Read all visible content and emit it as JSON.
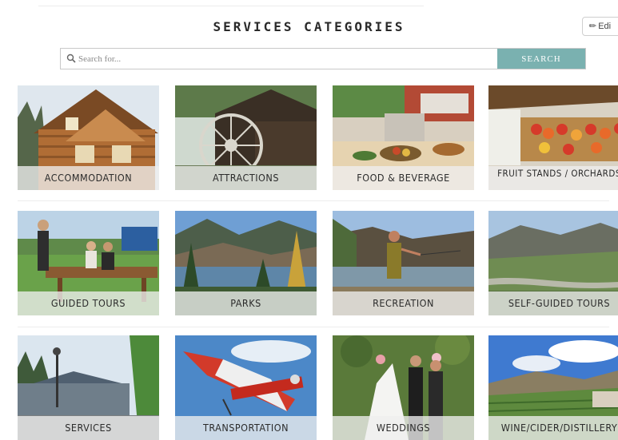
{
  "page": {
    "title": "SERVICES CATEGORIES",
    "edit_label": "Edi"
  },
  "search": {
    "placeholder": "Search for...",
    "button_label": "SEARCH"
  },
  "colors": {
    "search_button": "#7ab1b0",
    "label_band": "#eeeeee"
  },
  "icons": {
    "search": "magnifier-icon",
    "edit": "pencil-icon"
  },
  "categories": [
    {
      "label": "ACCOMMODATION"
    },
    {
      "label": "ATTRACTIONS"
    },
    {
      "label": "FOOD & BEVERAGE"
    },
    {
      "label": "FRUIT STANDS / ORCHARDS"
    },
    {
      "label": "GUIDED TOURS"
    },
    {
      "label": "PARKS"
    },
    {
      "label": "RECREATION"
    },
    {
      "label": "SELF-GUIDED TOURS"
    },
    {
      "label": "SERVICES"
    },
    {
      "label": "TRANSPORTATION"
    },
    {
      "label": "WEDDINGS"
    },
    {
      "label": "WINE/CIDER/DISTILLERY"
    }
  ]
}
